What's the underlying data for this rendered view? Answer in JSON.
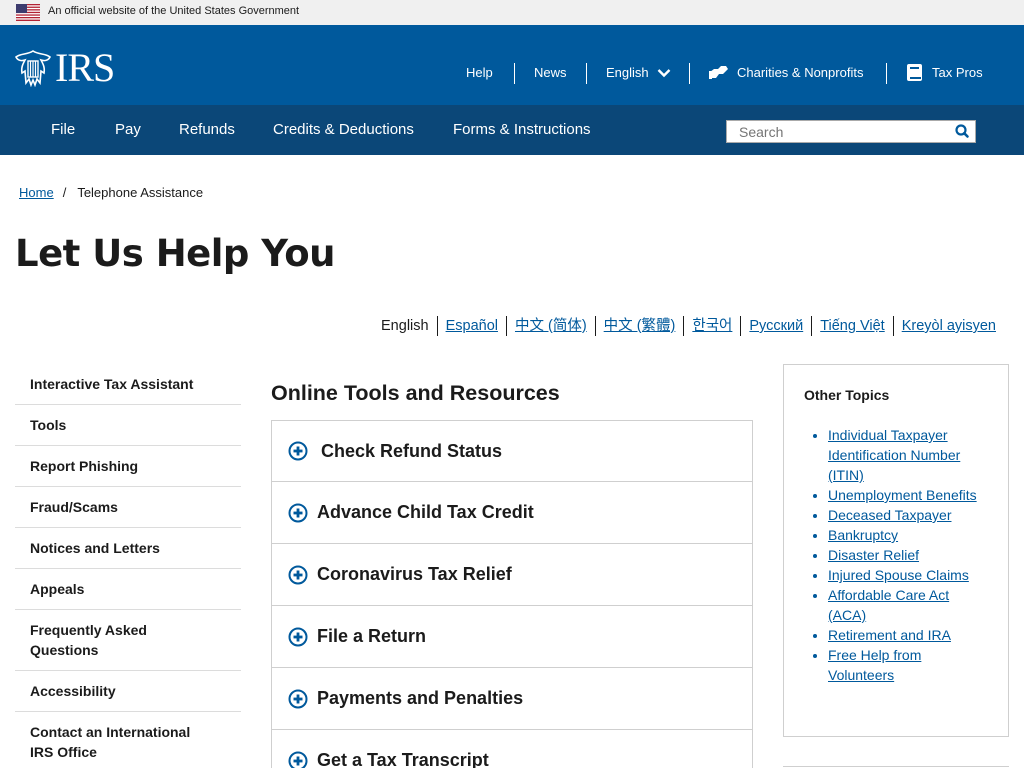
{
  "gov_banner": {
    "text": "An official website of the United States Government"
  },
  "header": {
    "logo_text": "IRS",
    "nav": {
      "help": "Help",
      "news": "News",
      "language": "English",
      "charities": "Charities & Nonprofits",
      "tax_pros": "Tax Pros"
    }
  },
  "main_nav": {
    "items": [
      "File",
      "Pay",
      "Refunds",
      "Credits & Deductions",
      "Forms & Instructions"
    ],
    "search_placeholder": "Search"
  },
  "breadcrumb": {
    "home": "Home",
    "current": "Telephone Assistance"
  },
  "page_title": "Let Us Help You",
  "languages": [
    "English",
    "Español",
    "中文 (简体)",
    "中文 (繁體)",
    "한국어",
    "Русский",
    "Tiếng Việt",
    "Kreyòl ayisyen"
  ],
  "sidebar": {
    "items": [
      "Interactive Tax Assistant",
      "Tools",
      "Report Phishing",
      "Fraud/Scams",
      "Notices and Letters",
      "Appeals",
      "Frequently Asked Questions",
      "Accessibility",
      "Contact an International IRS Office"
    ]
  },
  "main": {
    "section_title": "Online Tools and Resources",
    "accordion": [
      "Check Refund Status",
      "Advance Child Tax Credit",
      "Coronavirus Tax Relief",
      "File a Return",
      "Payments and Penalties",
      "Get a Tax Transcript"
    ]
  },
  "other_topics": {
    "title": "Other Topics",
    "links": [
      "Individual Taxpayer Identification Number (ITIN)",
      "Unemployment Benefits",
      "Deceased Taxpayer",
      "Bankruptcy",
      "Disaster Relief",
      "Injured Spouse Claims",
      "Affordable Care Act (ACA)",
      "Retirement and IRA",
      "Free Help from Volunteers"
    ]
  },
  "colors": {
    "header_blue": "#00599c",
    "nav_blue": "#0b4778",
    "link_blue": "#00599c",
    "banner_gray": "#f0f0f0"
  },
  "icons": {
    "flag": "us-flag-icon",
    "logo": "irs-eagle-logo",
    "language_chevron": "chevron-down-icon",
    "charities": "handshake-icon",
    "tax_pros": "book-icon",
    "search": "search-icon",
    "accordion_expand": "plus-circle-icon"
  }
}
